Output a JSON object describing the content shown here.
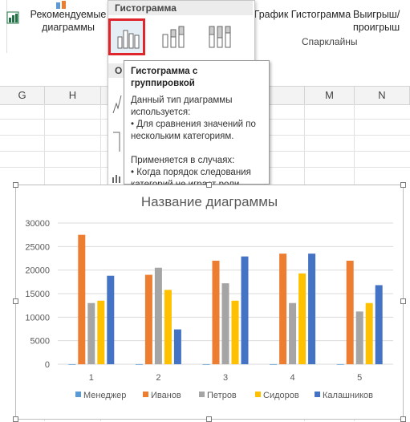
{
  "ribbon": {
    "recommended_charts": "Рекомендуемые диаграммы",
    "sparkline_line": "График",
    "sparkline_column": "Гистограмма",
    "sparkline_winloss": "Выигрыш/ проигрыш",
    "sparklines_group": "Спарклайны"
  },
  "dropdown": {
    "header": "Гистограмма",
    "second_header": "О"
  },
  "tooltip": {
    "title": "Гистограмма с группировкой",
    "line1": "Данный тип диаграммы используется:",
    "line2": "• Для сравнения значений по нескольким категориям.",
    "line3": "Применяется в случаях:",
    "line4": "• Когда порядок следования категорий не играет роли."
  },
  "columns": [
    "G",
    "H",
    "M",
    "N"
  ],
  "colors": {
    "highlight": "#e0262d",
    "s1": "#5b9bd5",
    "s2": "#ed7d31",
    "s3": "#a5a5a5",
    "s4": "#ffc000",
    "s5": "#4472c4"
  },
  "chart_data": {
    "type": "bar",
    "title": "Название диаграммы",
    "categories": [
      "1",
      "2",
      "3",
      "4",
      "5"
    ],
    "ylim": [
      0,
      30000
    ],
    "yticks": [
      "0",
      "5000",
      "10000",
      "15000",
      "20000",
      "25000",
      "30000"
    ],
    "grid": true,
    "legend": "bottom",
    "series": [
      {
        "name": "Менеджер",
        "values": [
          1,
          2,
          3,
          4,
          5
        ]
      },
      {
        "name": "Иванов",
        "values": [
          27500,
          19000,
          22000,
          23500,
          22000
        ]
      },
      {
        "name": "Петров",
        "values": [
          13000,
          20500,
          17200,
          13000,
          11200
        ]
      },
      {
        "name": "Сидоров",
        "values": [
          13500,
          15800,
          13500,
          19300,
          13000
        ]
      },
      {
        "name": "Калашников",
        "values": [
          18800,
          7400,
          22900,
          23500,
          16800
        ]
      }
    ]
  }
}
